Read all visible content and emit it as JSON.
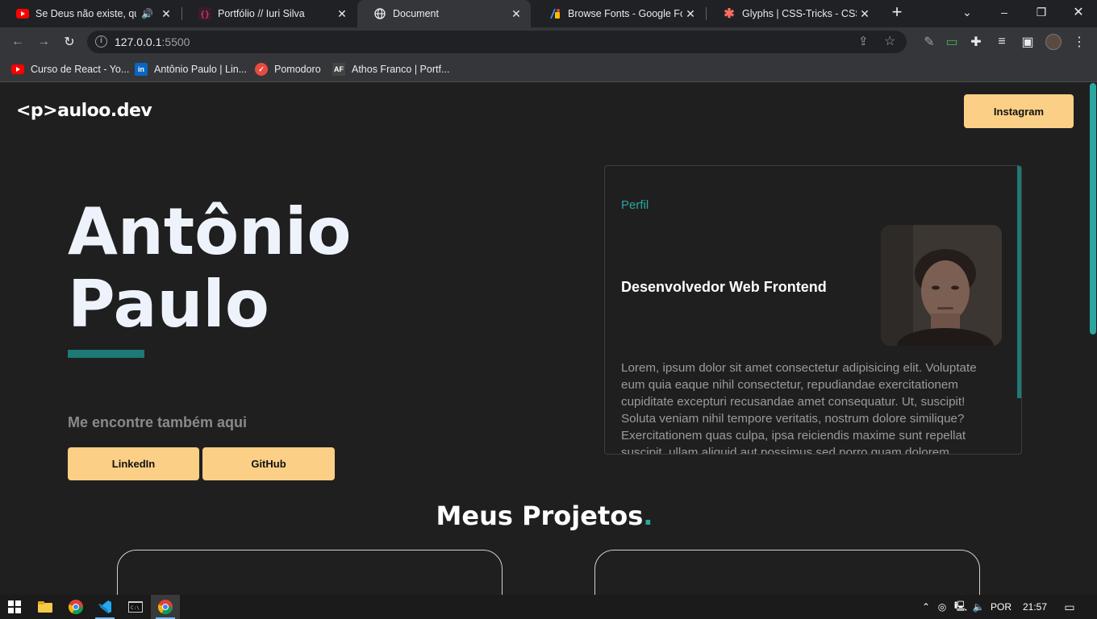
{
  "browser": {
    "tabs": [
      {
        "title": "Se Deus não existe, qual",
        "icon": "youtube-icon",
        "audio": true,
        "active": false
      },
      {
        "title": "Portfólio // Iuri Silva",
        "icon": "code-brackets-icon",
        "active": false
      },
      {
        "title": "Document",
        "icon": "globe-icon",
        "active": true
      },
      {
        "title": "Browse Fonts - Google Fonts",
        "icon": "google-fonts-icon",
        "active": false
      },
      {
        "title": "Glyphs | CSS-Tricks - CSS-Tric",
        "icon": "css-tricks-icon",
        "active": false
      }
    ],
    "url_host": "127.0.0.1",
    "url_port": ":5500",
    "bookmarks": [
      {
        "label": "Curso de React - Yo...",
        "icon": "youtube-icon"
      },
      {
        "label": "Antônio Paulo | Lin...",
        "icon": "linkedin-icon"
      },
      {
        "label": "Pomodoro",
        "icon": "tomato-icon"
      },
      {
        "label": "Athos Franco | Portf...",
        "icon": "af-icon"
      }
    ]
  },
  "site": {
    "logo": "<p>auloo.dev",
    "instagram_label": "Instagram",
    "hero": {
      "first_name": "Antônio",
      "last_name": "Paulo"
    },
    "find_me": "Me encontre também aqui",
    "linkedin_label": "LinkedIn",
    "github_label": "GitHub",
    "profile": {
      "section_label": "Perfil",
      "role": "Desenvolvedor Web Frontend",
      "bio": "Lorem, ipsum dolor sit amet consectetur adipisicing elit. Voluptate eum quia eaque nihil consectetur, repudiandae exercitationem cupiditate excepturi recusandae amet consequatur. Ut, suscipit! Soluta veniam nihil tempore veritatis, nostrum dolore similique? Exercitationem quas culpa, ipsa reiciendis maxime sunt repellat suscipit, ullam aliquid aut possimus sed porro quam dolorem"
    },
    "projects_title": "Meus Projetos",
    "projects_dot": ".",
    "colors": {
      "accent": "#fbcf86",
      "teal": "#1d7a76",
      "background": "#1f1f1f"
    }
  },
  "taskbar": {
    "language": "POR",
    "time": "21:57"
  }
}
